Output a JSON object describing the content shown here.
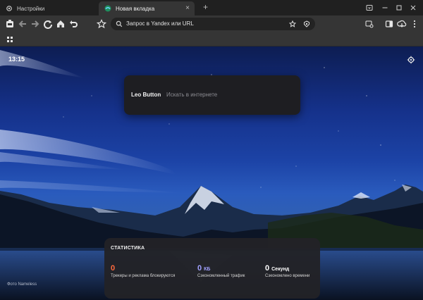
{
  "tabs": [
    {
      "label": "Настройки",
      "icon": "gear-icon"
    },
    {
      "label": "Новая вкладка",
      "icon": "brave-logo-icon"
    }
  ],
  "toolbar": {
    "address_text": "Запрос в Yandex или URL"
  },
  "newtab": {
    "clock": "13:15",
    "search": {
      "brand": "Leo Button",
      "placeholder": "Искать в интернете"
    },
    "photo_credit": "Фото Nameless",
    "stats": {
      "title": "СТАТИСТИКА",
      "items": [
        {
          "value": "0",
          "unit": "",
          "label": "Трекеры и реклама блокируются",
          "color": "#ff6a3d"
        },
        {
          "value": "0",
          "unit": "КБ",
          "label": "Сэкономленный трафик",
          "color": "#a0a0ff"
        },
        {
          "value": "0",
          "unit": "Секунд",
          "label": "Сэкономлено времени",
          "color": "#ffffff"
        }
      ]
    }
  },
  "colors": {
    "tab_active_bg": "#353535",
    "toolbar_bg": "#353535",
    "tabstrip_bg": "#202020",
    "stat_orange": "#ff6a3d",
    "stat_purple": "#a0a0ff"
  }
}
